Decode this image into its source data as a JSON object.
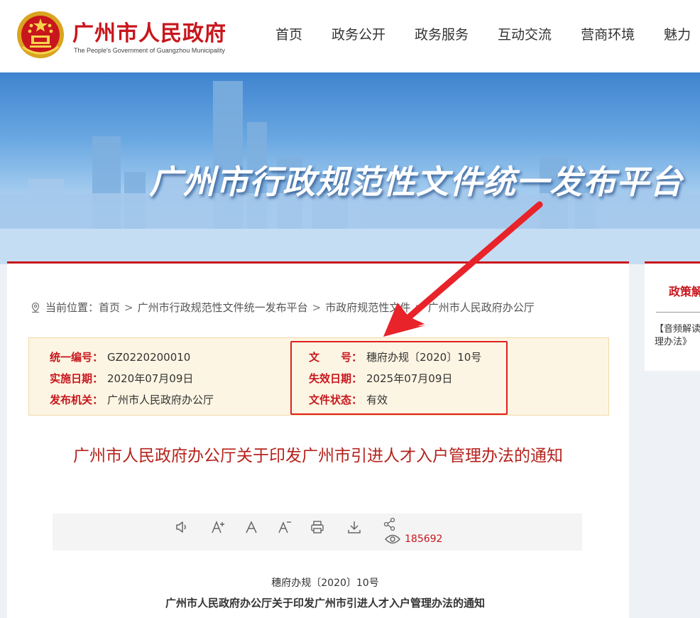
{
  "header": {
    "title": "广州市人民政府",
    "subtitle": "The People's Government of Guangzhou Municipality",
    "nav": [
      "首页",
      "政务公开",
      "政务服务",
      "互动交流",
      "营商环境",
      "魅力"
    ]
  },
  "banner": {
    "title": "广州市行政规范性文件统一发布平台"
  },
  "breadcrumb": {
    "prefix": "当前位置：",
    "items": [
      "首页",
      "广州市行政规范性文件统一发布平台",
      "市政府规范性文件",
      "广州市人民政府办公厅"
    ]
  },
  "info": {
    "code_label": "统一编号：",
    "code": "GZ0220200010",
    "impl_label": "实施日期：",
    "impl": "2020年07月09日",
    "issuer_label": "发布机关：",
    "issuer": "广州市人民政府办公厅",
    "docno_label": "文　　号：",
    "docno": "穗府办规〔2020〕10号",
    "expire_label": "失效日期：",
    "expire": "2025年07月09日",
    "status_label": "文件状态：",
    "status": "有效"
  },
  "document": {
    "title": "广州市人民政府办公厅关于印发广州市引进人才入户管理办法的通知",
    "number": "穗府办规〔2020〕10号",
    "subtitle": "广州市人民政府办公厅关于印发广州市引进人才入户管理办法的通知",
    "views": "185692"
  },
  "toolbar": {
    "icons": [
      "speaker-icon",
      "font-increase-icon",
      "font-normal-icon",
      "font-decrease-icon",
      "print-icon",
      "download-icon",
      "share-icon"
    ]
  },
  "sidebar": {
    "title": "政策解读",
    "item_line1": "【音频解读】",
    "item_line2": "理办法》"
  },
  "colors": {
    "accent": "#c8161d",
    "highlight": "#e21e1e",
    "info_bg": "#fdf5e3"
  }
}
